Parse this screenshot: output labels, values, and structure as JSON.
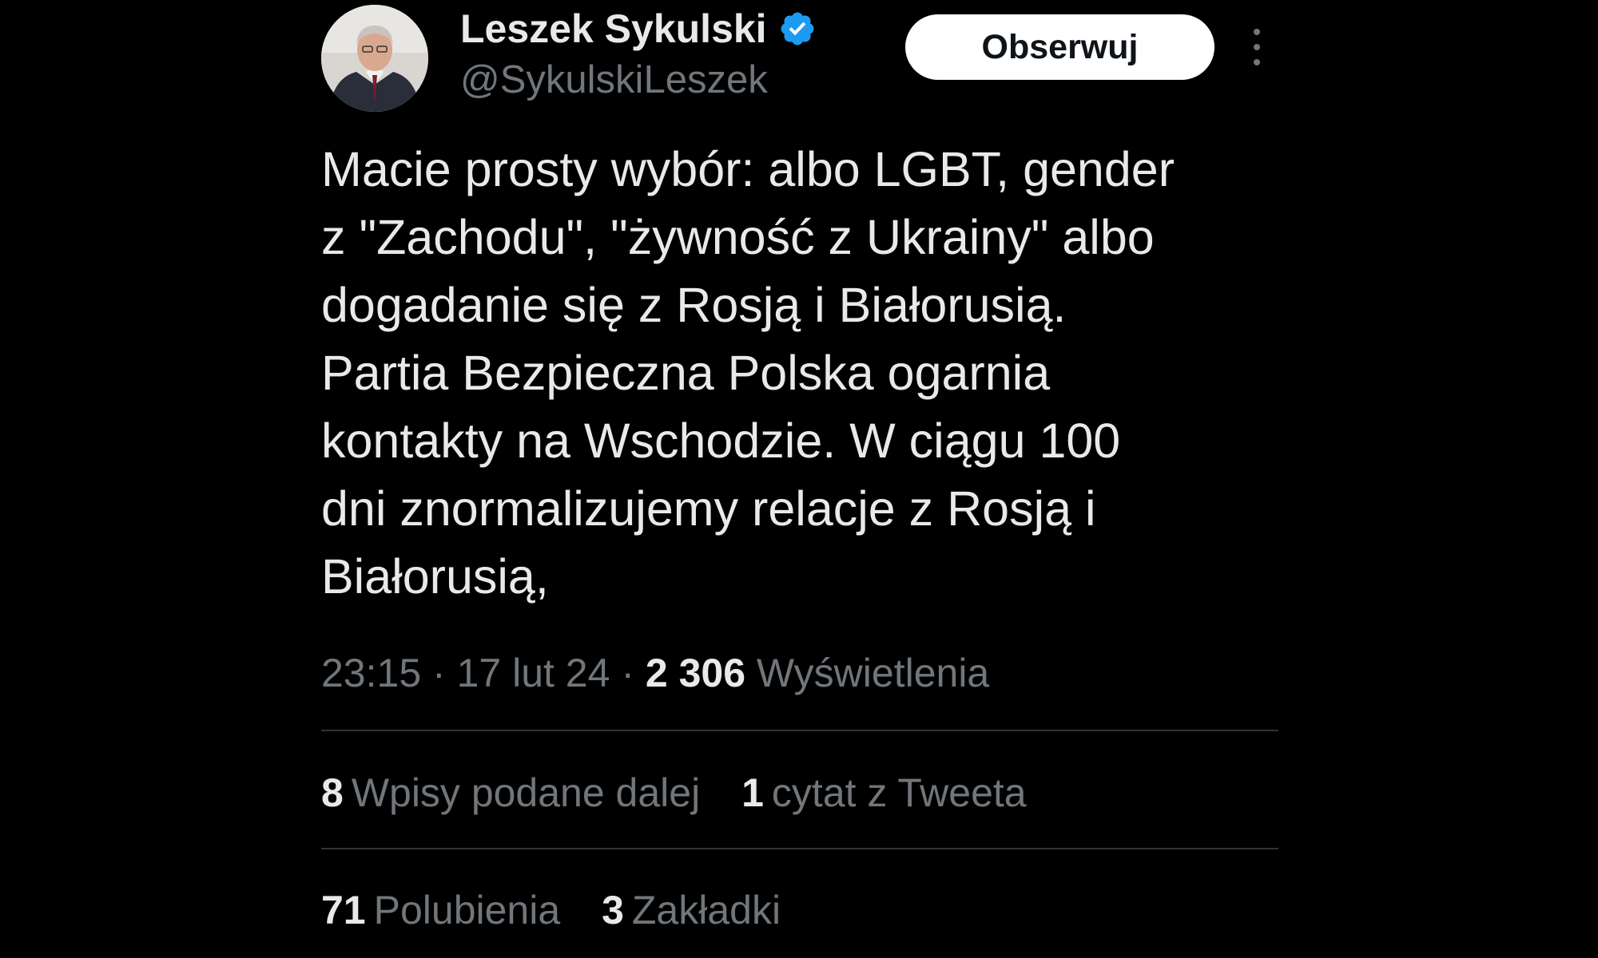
{
  "author": {
    "display_name": "Leszek Sykulski",
    "handle": "@SykulskiLeszek",
    "verified": true,
    "verified_color": "#1d9bf0"
  },
  "follow_button": {
    "label": "Obserwuj"
  },
  "tweet": {
    "lines": [
      "Macie prosty wybór: albo LGBT, gender",
      "z \"Zachodu\", \"żywność z Ukrainy\" albo",
      "dogadanie się z Rosją i Białorusią.",
      "Partia Bezpieczna Polska ogarnia",
      "kontakty na Wschodzie. W ciągu 100",
      "dni znormalizujemy relacje z Rosją i",
      "Białorusią,"
    ]
  },
  "meta": {
    "time": "23:15",
    "date": "17 lut 24",
    "separator": "·",
    "views_count": "2 306",
    "views_label": "Wyświetlenia"
  },
  "stats": {
    "reposts_count": "8",
    "reposts_label": "Wpisy podane dalej",
    "quotes_count": "1",
    "quotes_label": "cytat z Tweeta",
    "likes_count": "71",
    "likes_label": "Polubienia",
    "bookmarks_count": "3",
    "bookmarks_label": "Zakładki"
  },
  "colors": {
    "background": "#000000",
    "primary_text": "#e7e9ea",
    "secondary_text": "#71767b",
    "divider": "#2f3336",
    "button_bg": "#ffffff"
  }
}
